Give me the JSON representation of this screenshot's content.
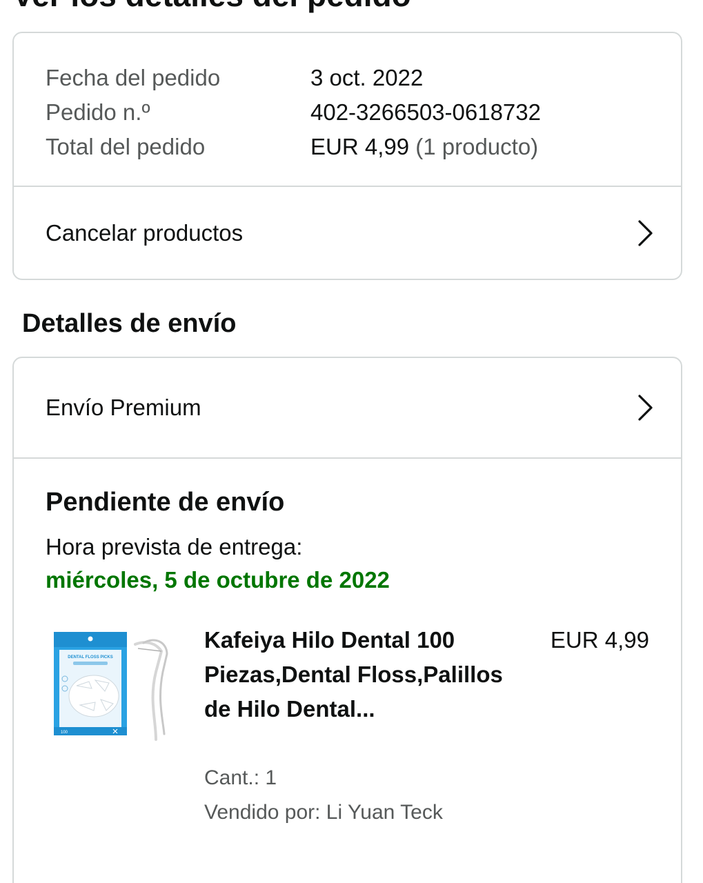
{
  "page": {
    "title": "Ver los detalles del pedido"
  },
  "order_summary": {
    "date_label": "Fecha del pedido",
    "date_value": "3 oct. 2022",
    "number_label": "Pedido n.º",
    "number_value": "402-3266503-0618732",
    "total_label": "Total del pedido",
    "total_value": "EUR 4,99",
    "total_count": "(1 producto)",
    "cancel_label": "Cancelar productos"
  },
  "shipping": {
    "section_title": "Detalles de envío",
    "method_label": "Envío Premium",
    "status": "Pendiente de envío",
    "eta_label": "Hora prevista de entrega:",
    "eta_date": "miércoles, 5 de octubre de 2022"
  },
  "product": {
    "title": "Kafeiya Hilo Dental 100 Piezas,Dental Floss,Palillos de Hilo Dental...",
    "price": "EUR 4,99",
    "quantity": "Cant.: 1",
    "seller": "Vendido por: Li Yuan Teck",
    "package_text": "DENTAL FLOSS PICKS",
    "package_count": "100",
    "icon": "dental-floss-package"
  },
  "colors": {
    "eta_green": "#007600",
    "border": "#d5d9d9",
    "secondary_text": "#565959",
    "package_blue": "#1e9be0"
  }
}
